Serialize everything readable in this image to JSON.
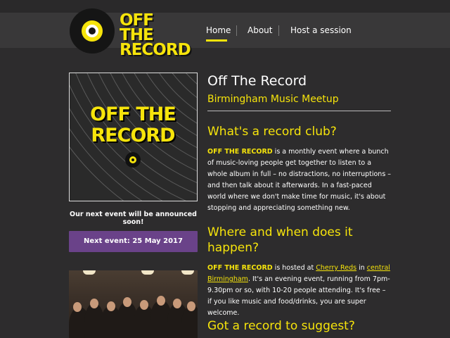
{
  "header": {
    "logo_line1": "OFF THE",
    "logo_line2": "RECORD",
    "nav": [
      {
        "label": "Home"
      },
      {
        "label": "About"
      },
      {
        "label": "Host a session"
      }
    ],
    "active_index": 0
  },
  "sidebar": {
    "art_line1": "OFF THE",
    "art_line2": "RECORD",
    "announcement": "Our next event will be announced soon!",
    "next_event_button": "Next event: 25 May 2017"
  },
  "main": {
    "title": "Off The Record",
    "subtitle": "Birmingham Music Meetup",
    "sections": [
      {
        "heading": "What's a record club?",
        "brand": "OFF THE RECORD",
        "text": " is a monthly event where a bunch of music-loving people get together to listen to a whole album in full – no distractions, no interruptions – and then talk about it afterwards. In a fast-paced world where we don't make time for music, it's about stopping and appreciating something new."
      },
      {
        "heading": "Where and when does it happen?",
        "brand": "OFF THE RECORD",
        "text_before": " is hosted at ",
        "link1": "Cherry Reds",
        "text_mid": " in ",
        "link2": "central Birmingham",
        "text_after": ". It's an evening event, running from 7pm-9.30pm or so, with 10-20 people attending. It's free – if you like music and food/drinks, you are super welcome."
      },
      {
        "heading": "Got a record to suggest?"
      }
    ]
  },
  "colors": {
    "background": "#2d2c2d",
    "header": "#393839",
    "accent": "#f6e40b",
    "button": "#6a4289"
  },
  "icons": [
    "vinyl-record-icon"
  ]
}
